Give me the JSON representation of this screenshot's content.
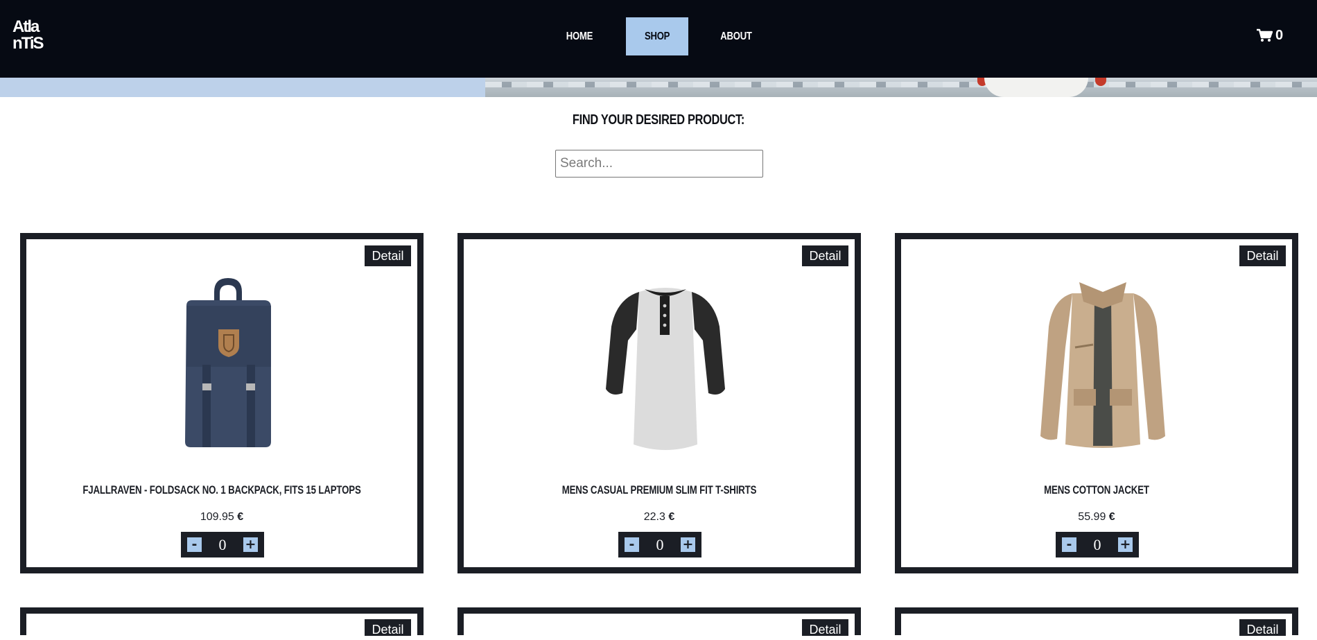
{
  "header": {
    "logo_alt": "Atlantis",
    "nav": [
      {
        "label": "HOME"
      },
      {
        "label": "SHOP"
      },
      {
        "label": "ABOUT"
      }
    ],
    "cart_count": "0",
    "active_nav": "SHOP"
  },
  "search": {
    "heading": "FIND YOUR DESIRED PRODUCT:",
    "placeholder": "Search..."
  },
  "products": [
    {
      "title": "FJALLRAVEN - FOLDSACK NO. 1 BACKPACK, FITS 15 LAPTOPS",
      "price": "109.95",
      "currency": "€",
      "qty": "0",
      "detail_label": "Detail",
      "icon": "backpack-image"
    },
    {
      "title": "MENS CASUAL PREMIUM SLIM FIT T-SHIRTS",
      "price": "22.3",
      "currency": "€",
      "qty": "0",
      "detail_label": "Detail",
      "icon": "tshirt-image"
    },
    {
      "title": "MENS COTTON JACKET",
      "price": "55.99",
      "currency": "€",
      "qty": "0",
      "detail_label": "Detail",
      "icon": "jacket-image"
    }
  ],
  "row2": [
    {
      "detail_label": "Detail"
    },
    {
      "detail_label": "Detail"
    },
    {
      "detail_label": "Detail"
    }
  ],
  "qty_controls": {
    "minus": "-",
    "plus": "+"
  },
  "colors": {
    "navbar": "#060a13",
    "accent": "#a9c9ec",
    "card_border": "#1b1e25"
  }
}
